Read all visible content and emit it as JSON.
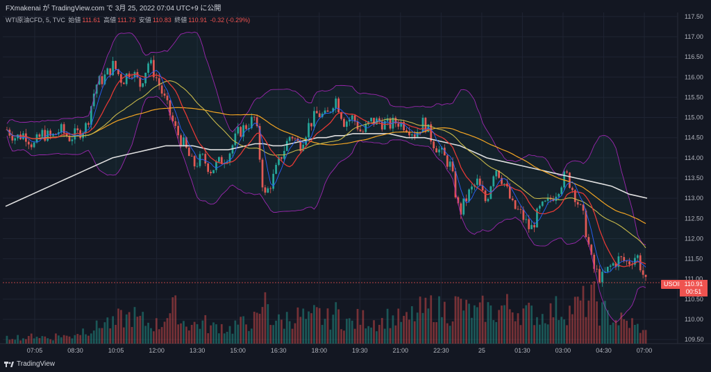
{
  "header": {
    "title": "FXmakenai が TradingView.com で 3月 25, 2022 07:04 UTC+9 に公開"
  },
  "legend": {
    "symbol": "WTI原油CFD, 5, TVC",
    "open_label": "始値",
    "open": "111.61",
    "high_label": "高値",
    "high": "111.73",
    "low_label": "安値",
    "low": "110.83",
    "close_label": "終値",
    "close": "110.91",
    "change": "-0.32 (-0.29%)"
  },
  "badges": {
    "symbol_badge": "USOIL",
    "price": "110.91",
    "countdown": "00:51"
  },
  "brand": {
    "name": "TradingView"
  },
  "colors": {
    "bg": "#131722",
    "up": "#26a69a",
    "down": "#ef5350",
    "grid": "#1f2433",
    "bb": "#9c27b0",
    "ma_white": "#e0e0e0",
    "ma_orange": "#f5a623",
    "ma_red": "#e53935",
    "ma_yellow": "#c8b94b",
    "ma_blue": "#2962ff",
    "rci_green": "#4caf50"
  },
  "chart_data": {
    "type": "candlestick",
    "symbol": "WTI原油CFD",
    "timeframe": "5",
    "x_ticks": [
      "07:05",
      "08:30",
      "10:05",
      "12:00",
      "13:30",
      "15:00",
      "16:30",
      "18:00",
      "19:30",
      "21:00",
      "22:30",
      "25",
      "01:30",
      "03:00",
      "04:30",
      "07:00"
    ],
    "y_ticks": [
      "117.50",
      "117.00",
      "116.50",
      "116.00",
      "115.50",
      "115.00",
      "114.50",
      "114.00",
      "113.50",
      "113.00",
      "112.50",
      "112.00",
      "111.50",
      "111.00",
      "110.50",
      "110.00",
      "109.50"
    ],
    "ylim": [
      109.4,
      117.6
    ],
    "last_price": 110.91,
    "price_path": [
      114.7,
      114.5,
      114.6,
      114.3,
      114.6,
      114.5,
      114.7,
      114.5,
      114.6,
      114.8,
      115.8,
      116.0,
      116.3,
      115.9,
      116.2,
      115.8,
      116.4,
      115.9,
      115.3,
      114.7,
      114.3,
      113.8,
      114.0,
      113.7,
      113.9,
      114.1,
      114.6,
      114.8,
      115.0,
      113.0,
      113.5,
      114.1,
      114.6,
      114.3,
      114.8,
      115.1,
      115.0,
      115.5,
      114.9,
      115.0,
      114.6,
      114.9,
      114.9,
      114.8,
      114.9,
      114.8,
      114.6,
      114.9,
      114.4,
      114.1,
      113.8,
      112.6,
      113.1,
      113.4,
      112.9,
      113.8,
      113.4,
      112.8,
      112.6,
      112.2,
      112.7,
      112.9,
      113.2,
      113.6,
      113.1,
      112.5,
      111.3,
      111.0,
      111.3,
      111.5,
      111.4,
      111.6,
      110.9
    ],
    "volume": [
      4,
      5,
      4,
      6,
      5,
      4,
      6,
      5,
      8,
      10,
      12,
      16,
      14,
      18,
      20,
      17,
      15,
      14,
      22,
      25,
      16,
      14,
      15,
      12,
      13,
      11,
      14,
      15,
      17,
      30,
      18,
      16,
      19,
      20,
      17,
      21,
      18,
      22,
      17,
      15,
      18,
      17,
      16,
      19,
      18,
      17,
      21,
      24,
      27,
      25,
      23,
      28,
      24,
      22,
      25,
      23,
      27,
      26,
      24,
      22,
      20,
      23,
      25,
      24,
      27,
      30,
      32,
      23,
      20,
      17,
      15,
      12,
      8
    ],
    "series": [
      {
        "name": "MA white",
        "values": [
          112.8,
          112.9,
          113.0,
          113.1,
          113.2,
          113.3,
          113.4,
          113.5,
          113.6,
          113.7,
          113.8,
          113.9,
          114.0,
          114.05,
          114.1,
          114.15,
          114.2,
          114.25,
          114.3,
          114.3,
          114.3,
          114.3,
          114.25,
          114.2,
          114.2,
          114.2,
          114.25,
          114.3,
          114.35,
          114.35,
          114.3,
          114.3,
          114.35,
          114.4,
          114.45,
          114.5,
          114.5,
          114.55,
          114.55,
          114.6,
          114.6,
          114.6,
          114.6,
          114.6,
          114.55,
          114.5,
          114.5,
          114.5,
          114.45,
          114.4,
          114.35,
          114.3,
          114.2,
          114.1,
          114.0,
          113.95,
          113.9,
          113.85,
          113.8,
          113.75,
          113.7,
          113.65,
          113.6,
          113.55,
          113.5,
          113.45,
          113.4,
          113.35,
          113.3,
          113.2,
          113.1,
          113.05,
          113.0
        ]
      }
    ]
  }
}
